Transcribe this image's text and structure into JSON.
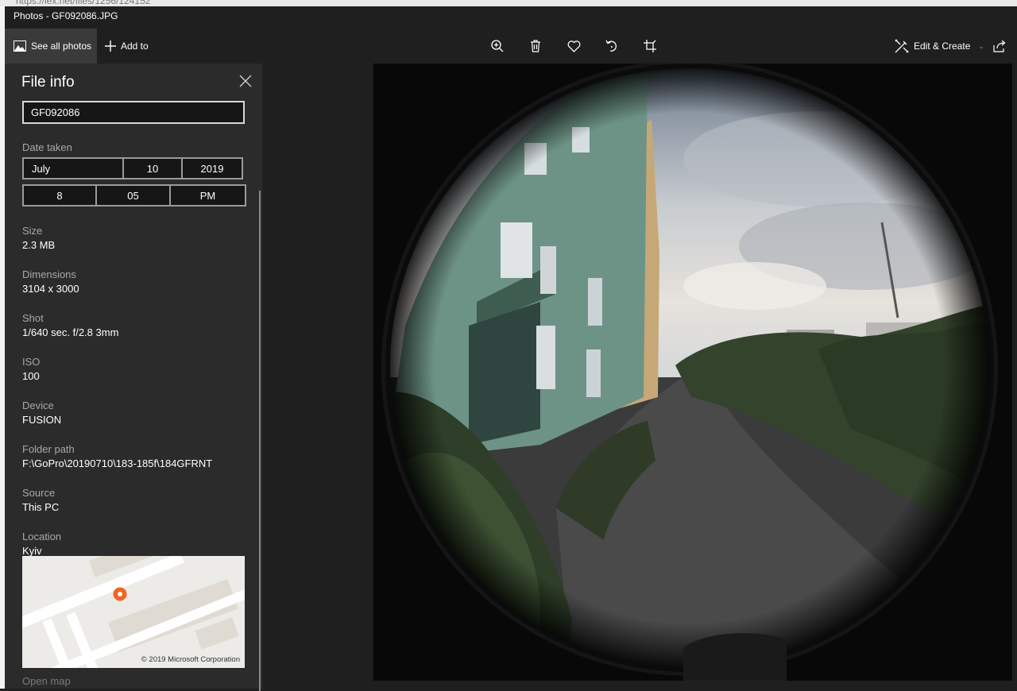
{
  "background": {
    "url_fragment": "https://lex.net/files/1256/124152"
  },
  "window": {
    "title": "Photos - GF092086.JPG"
  },
  "toolbar": {
    "see_all": "See all photos",
    "add_to": "Add to",
    "edit_create": "Edit & Create",
    "icons": [
      "zoom-in-icon",
      "delete-icon",
      "favorite-icon",
      "rotate-icon",
      "crop-icon",
      "share-icon"
    ]
  },
  "panel": {
    "title": "File info",
    "file_name": "GF092086",
    "date_taken_label": "Date taken",
    "date": {
      "month": "July",
      "day": "10",
      "year": "2019"
    },
    "time": {
      "hour": "8",
      "minute": "05",
      "ampm": "PM"
    },
    "fields": [
      {
        "label": "Size",
        "value": "2.3 MB"
      },
      {
        "label": "Dimensions",
        "value": "3104 x 3000"
      },
      {
        "label": "Shot",
        "value": "1/640 sec. f/2.8 3mm"
      },
      {
        "label": "ISO",
        "value": "100"
      },
      {
        "label": "Device",
        "value": "FUSION"
      },
      {
        "label": "Folder path",
        "value": "F:\\GoPro\\20190710\\183-185f\\184GFRNT"
      },
      {
        "label": "Source",
        "value": "This PC"
      },
      {
        "label": "Location",
        "value": "Kyiv"
      }
    ],
    "map_copyright": "© 2019 Microsoft Corporation",
    "open_map": "Open map"
  },
  "colors": {
    "app_bg": "#1f1f1f",
    "panel_bg": "#2b2b2b",
    "selected_button_bg": "#3a3a3a",
    "map_pin": "#f26522"
  }
}
